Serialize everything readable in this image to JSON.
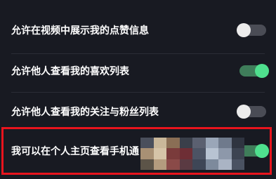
{
  "settings": {
    "items": [
      {
        "label": "允许在视频中展示我的点赞信息",
        "enabled": false
      },
      {
        "label": "允许他人查看我的喜欢列表",
        "enabled": true
      },
      {
        "label": "允许他人查看我的关注与粉丝列表",
        "enabled": false
      },
      {
        "label": "我可以在个人主页查看手机通",
        "enabled": true
      }
    ]
  },
  "colors": {
    "background": "#181a22",
    "toggle_on": "#4fe08e",
    "toggle_off": "#ececec",
    "highlight": "#e8141d"
  }
}
